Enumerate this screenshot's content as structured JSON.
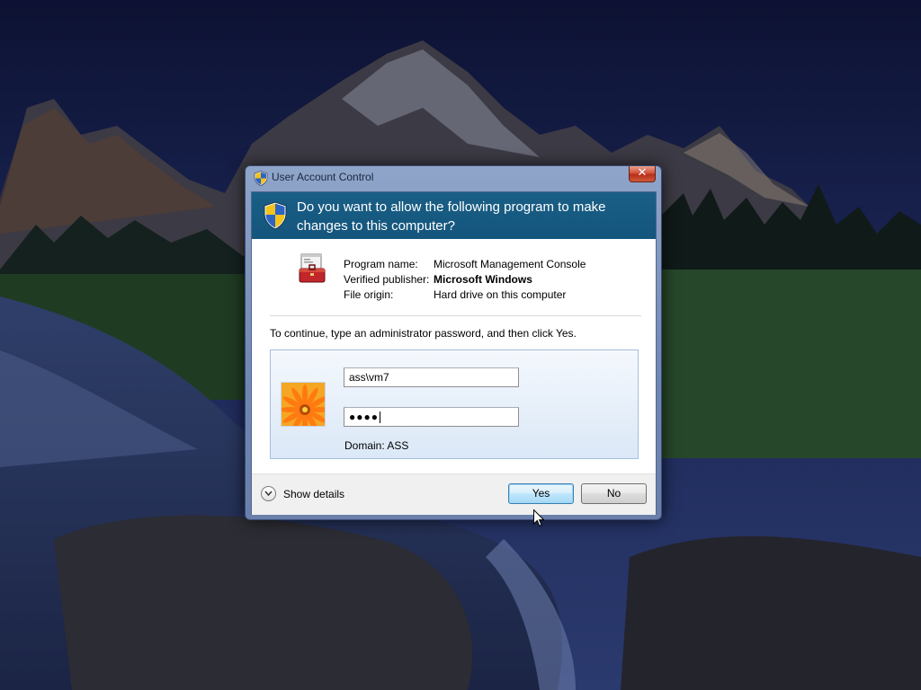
{
  "window": {
    "title": "User Account Control",
    "close_glyph": "✕"
  },
  "header": {
    "question": "Do you want to allow the following program to make changes to this computer?",
    "icon": "uac-shield-icon"
  },
  "program_info": {
    "icon": "management-console-toolbox-icon",
    "rows": [
      {
        "label": "Program name:",
        "value": "Microsoft Management Console"
      },
      {
        "label": "Verified publisher:",
        "value": "Microsoft Windows"
      },
      {
        "label": "File origin:",
        "value": "Hard drive on this computer"
      }
    ]
  },
  "instruction": "To continue, type an administrator password, and then click Yes.",
  "credentials": {
    "user_tile": "orange-flower-avatar",
    "username_value": "ass\\vm7",
    "password_masked": "●●●●",
    "domain_text": "Domain: ASS"
  },
  "footer": {
    "show_details_label": "Show details",
    "yes_label": "Yes",
    "no_label": "No"
  },
  "colors": {
    "header_bg": "#1a5f86",
    "frame": "#7a90ba",
    "close_red": "#c7432a",
    "default_button": "#bee6fd"
  }
}
